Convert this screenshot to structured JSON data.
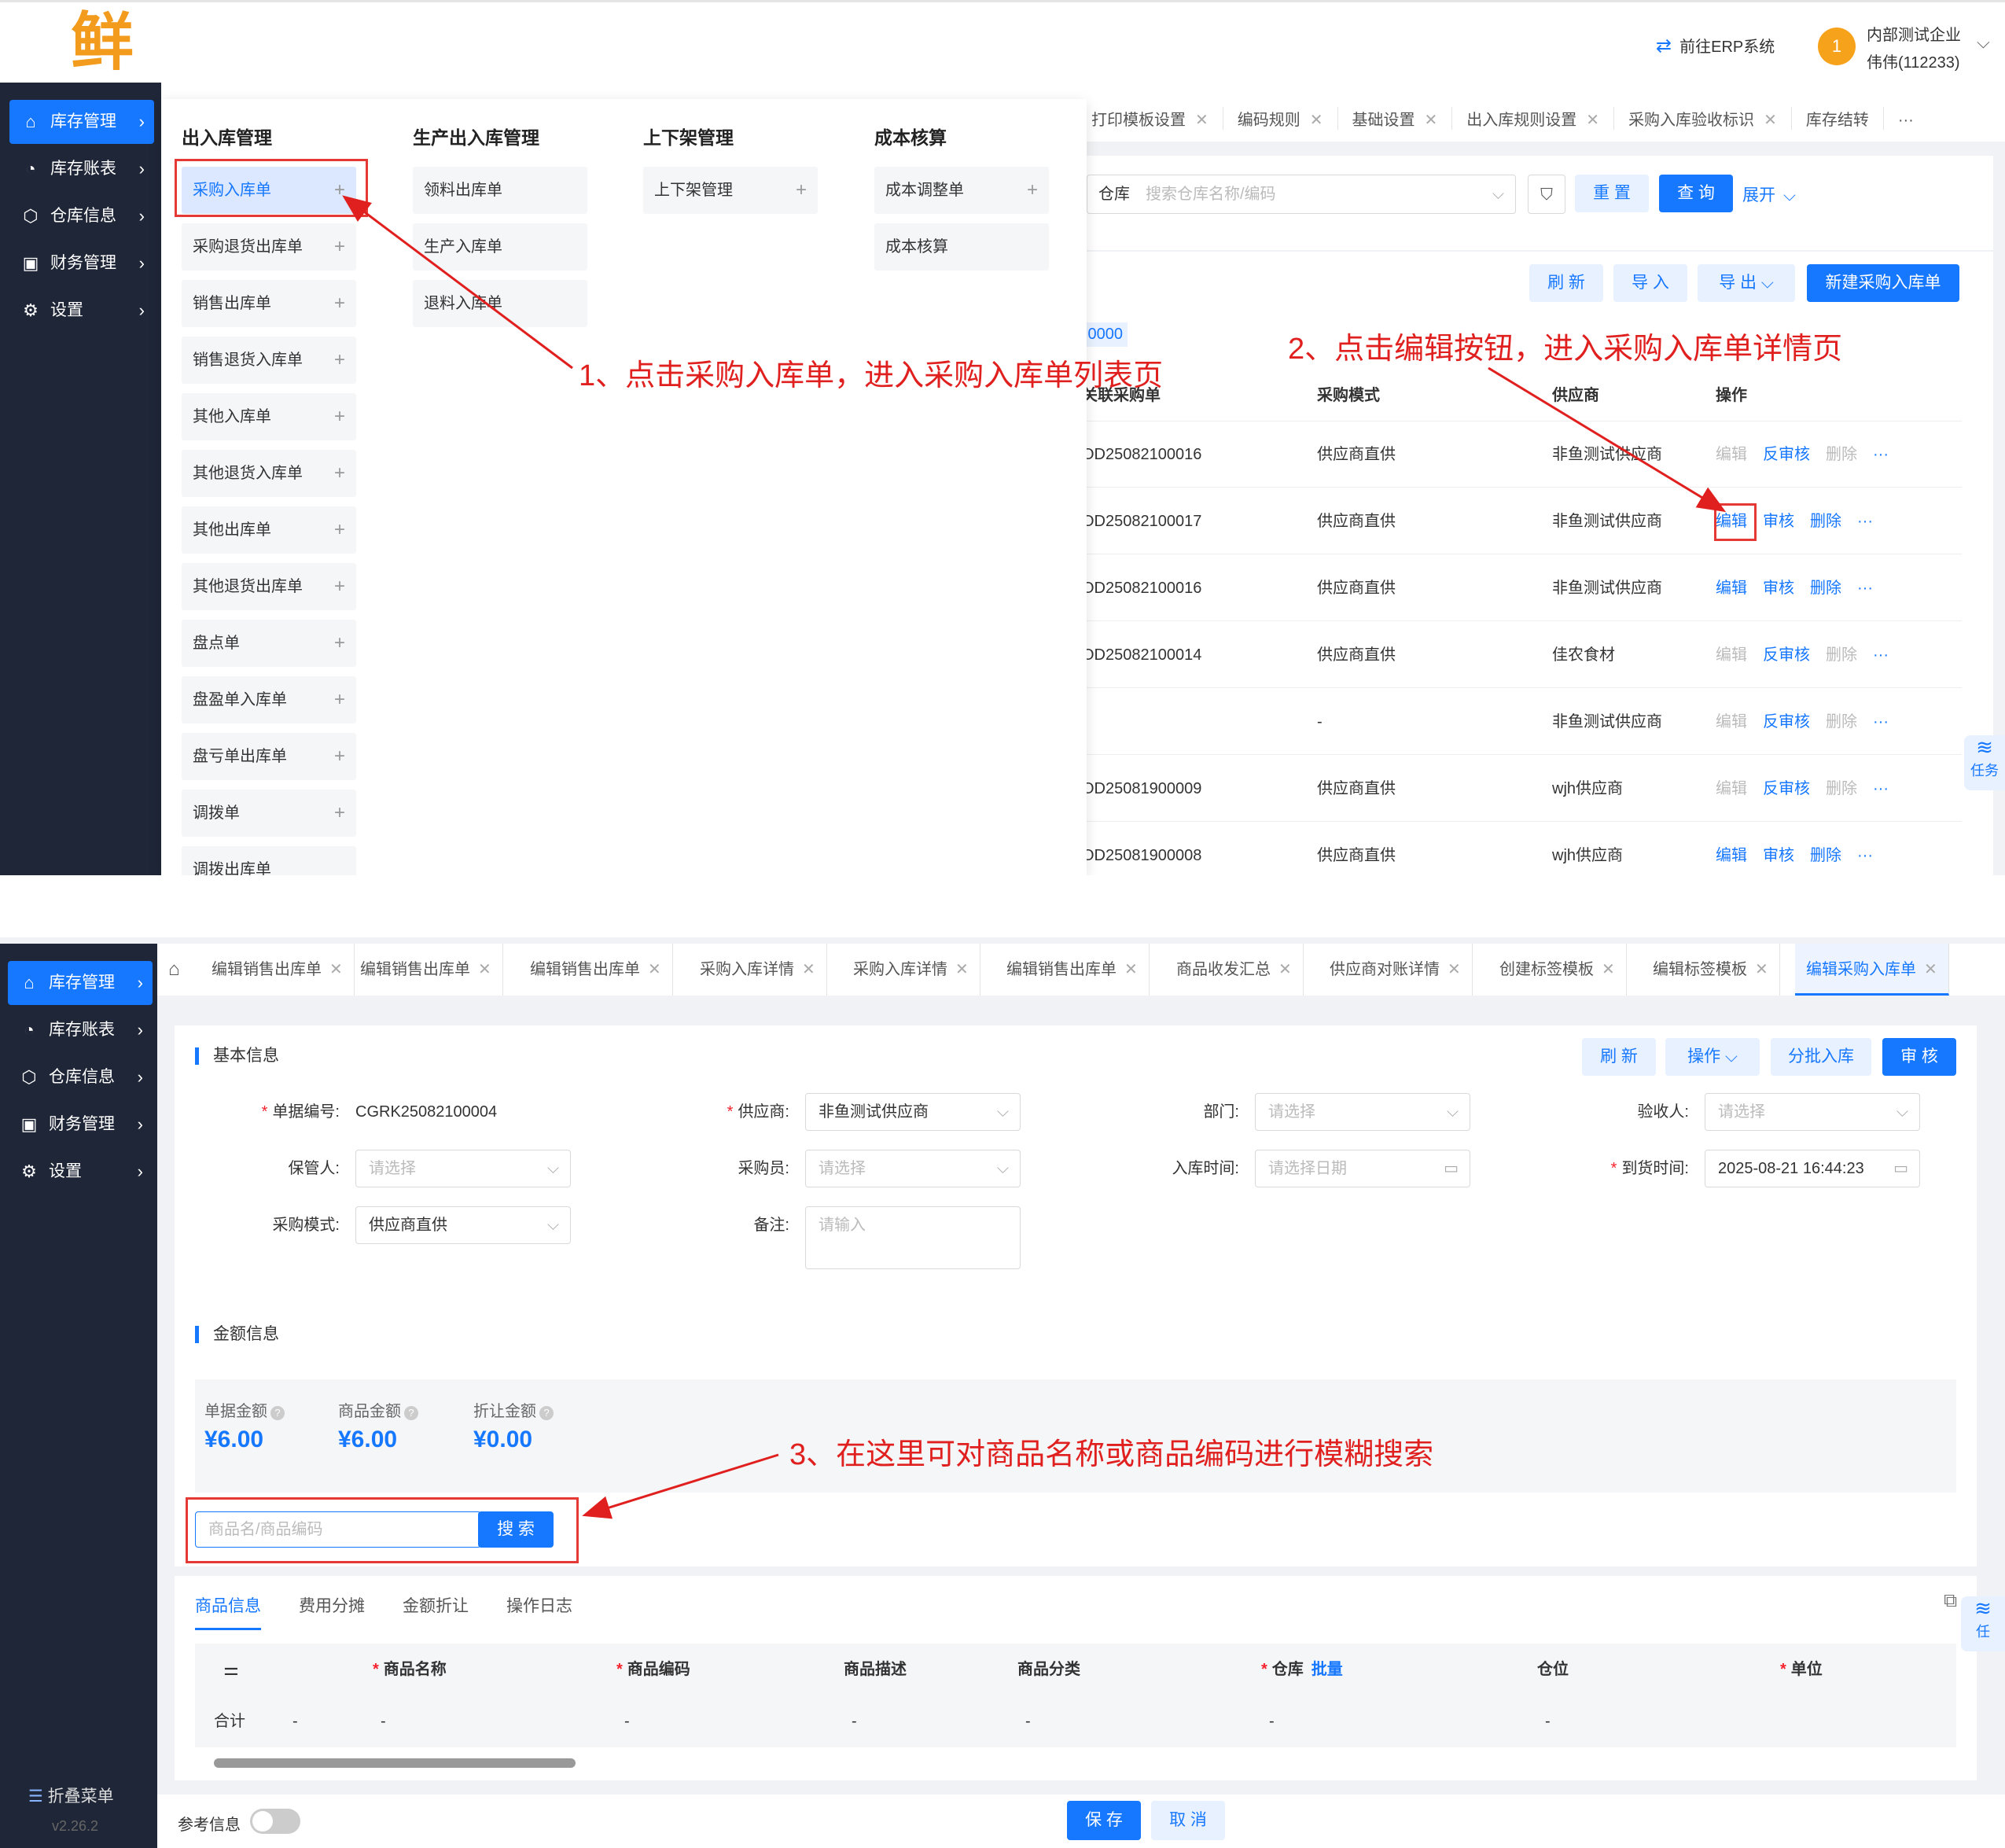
{
  "header": {
    "logo_char": "鲜",
    "erp_link": "前往ERP系统",
    "avatar_text": "1",
    "company": "内部测试企业",
    "user": "伟伟(112233)"
  },
  "sidebar": {
    "items": [
      {
        "label": "库存管理",
        "icon": "home-icon"
      },
      {
        "label": "库存账表",
        "icon": "pie-chart-icon"
      },
      {
        "label": "仓库信息",
        "icon": "cube-icon"
      },
      {
        "label": "财务管理",
        "icon": "finance-icon"
      },
      {
        "label": "设置",
        "icon": "gear-icon"
      }
    ],
    "collapse": "折叠菜单",
    "version": "v2.26.2"
  },
  "panel1": {
    "tabs": [
      "打印模板设置",
      "编码规则",
      "基础设置",
      "出入库规则设置",
      "采购入库验收标识",
      "库存结转"
    ],
    "more": "···",
    "filter": {
      "label": "仓库",
      "placeholder": "搜索仓库名称/编码"
    },
    "buttons": {
      "reset": "重 置",
      "query": "查 询",
      "expand": "展开",
      "refresh": "刷 新",
      "import": "导 入",
      "export": "导 出",
      "create": "新建采购入库单"
    },
    "amount_snippet": ".0000",
    "columns": [
      "关联采购单",
      "采购模式",
      "供应商",
      "操作"
    ],
    "rows": [
      {
        "order": "OD25082100016",
        "mode": "供应商直供",
        "supplier": "非鱼测试供应商",
        "ops": [
          "编辑",
          "反审核",
          "删除",
          "···"
        ],
        "approved": true
      },
      {
        "order": "OD25082100017",
        "mode": "供应商直供",
        "supplier": "非鱼测试供应商",
        "ops": [
          "编辑",
          "审核",
          "删除",
          "···"
        ],
        "approved": false
      },
      {
        "order": "OD25082100016",
        "mode": "供应商直供",
        "supplier": "非鱼测试供应商",
        "ops": [
          "编辑",
          "审核",
          "删除",
          "···"
        ],
        "approved": false
      },
      {
        "order": "OD25082100014",
        "mode": "供应商直供",
        "supplier": "佳农食材",
        "ops": [
          "编辑",
          "反审核",
          "删除",
          "···"
        ],
        "approved": true
      },
      {
        "order": "",
        "mode": "-",
        "supplier": "非鱼测试供应商",
        "ops": [
          "编辑",
          "反审核",
          "删除",
          "···"
        ],
        "approved": true
      },
      {
        "order": "OD25081900009",
        "mode": "供应商直供",
        "supplier": "wjh供应商",
        "ops": [
          "编辑",
          "反审核",
          "删除",
          "···"
        ],
        "approved": true
      },
      {
        "order": "OD25081900008",
        "mode": "供应商直供",
        "supplier": "wjh供应商",
        "ops": [
          "编辑",
          "审核",
          "删除",
          "···"
        ],
        "approved": false
      }
    ],
    "task_label": "任务",
    "menu": {
      "groups": [
        {
          "title": "出入库管理",
          "items": [
            "采购入库单",
            "采购退货出库单",
            "销售出库单",
            "销售退货入库单",
            "其他入库单",
            "其他退货入库单",
            "其他出库单",
            "其他退货出库单",
            "盘点单",
            "盘盈单入库单",
            "盘亏单出库单",
            "调拨单",
            "调拨出库单"
          ]
        },
        {
          "title": "生产出入库管理",
          "items": [
            "领料出库单",
            "生产入库单",
            "退料入库单"
          ]
        },
        {
          "title": "上下架管理",
          "items": [
            "上下架管理"
          ]
        },
        {
          "title": "成本核算",
          "items": [
            "成本调整单",
            "成本核算"
          ]
        }
      ]
    },
    "annotation1": "1、点击采购入库单，进入采购入库单列表页",
    "annotation2": "2、点击编辑按钮，进入采购入库单详情页"
  },
  "panel2": {
    "tabs": [
      "编辑销售出库单",
      "编辑销售出库单",
      "编辑销售出库单",
      "采购入库详情",
      "采购入库详情",
      "编辑销售出库单",
      "商品收发汇总",
      "供应商对账详情",
      "创建标签模板",
      "编辑标签模板",
      "编辑采购入库单"
    ],
    "basic": {
      "title": "基本信息",
      "buttons": {
        "refresh": "刷 新",
        "ops": "操作",
        "split": "分批入库",
        "audit": "审 核"
      },
      "fields": {
        "doc_no": {
          "label": "单据编号:",
          "value": "CGRK25082100004"
        },
        "supplier": {
          "label": "供应商:",
          "value": "非鱼测试供应商"
        },
        "dept": {
          "label": "部门:",
          "placeholder": "请选择"
        },
        "inspector": {
          "label": "验收人:",
          "placeholder": "请选择"
        },
        "keeper": {
          "label": "保管人:",
          "placeholder": "请选择"
        },
        "buyer": {
          "label": "采购员:",
          "placeholder": "请选择"
        },
        "in_time": {
          "label": "入库时间:",
          "placeholder": "请选择日期"
        },
        "arrive_time": {
          "label": "到货时间:",
          "value": "2025-08-21 16:44:23"
        },
        "mode": {
          "label": "采购模式:",
          "value": "供应商直供"
        },
        "remark": {
          "label": "备注:",
          "placeholder": "请输入"
        }
      }
    },
    "amount": {
      "title": "金额信息",
      "items": [
        {
          "label": "单据金额",
          "value": "¥6.00"
        },
        {
          "label": "商品金额",
          "value": "¥6.00"
        },
        {
          "label": "折让金额",
          "value": "¥0.00"
        }
      ]
    },
    "search": {
      "placeholder": "商品名/商品编码",
      "button": "搜 索"
    },
    "annotation3": "3、在这里可对商品名称或商品编码进行模糊搜索",
    "subtabs": [
      "商品信息",
      "费用分摊",
      "金额折让",
      "操作日志"
    ],
    "table": {
      "columns": [
        "商品名称",
        "商品编码",
        "商品描述",
        "商品分类",
        "仓库",
        "仓位",
        "单位"
      ],
      "batch": "批量",
      "total_label": "合计",
      "dash": "-"
    },
    "footer": {
      "ref_label": "参考信息",
      "save": "保 存",
      "cancel": "取 消"
    },
    "task_label": "任"
  },
  "colors": {
    "primary": "#1677ff",
    "sidebar": "#1f2637",
    "annotation": "#e0201f"
  }
}
